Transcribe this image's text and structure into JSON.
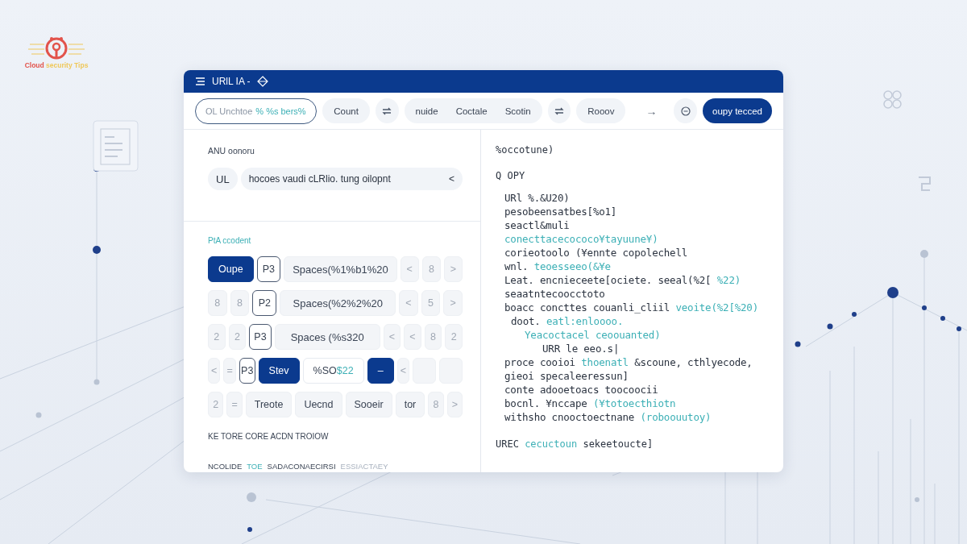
{
  "logo": {
    "words": [
      {
        "text": "Cloud",
        "kind": "primary"
      },
      {
        "text": "security Tips",
        "kind": "secondary"
      }
    ]
  },
  "window": {
    "title": "URlL IA -"
  },
  "toolbar": {
    "field": {
      "value": "OL Unchtoe",
      "accent": "% %s bers%"
    },
    "items": [
      {
        "kind": "chip",
        "text": "Count"
      },
      {
        "kind": "icon"
      },
      {
        "kind": "group",
        "texts": [
          "nuide",
          "Coctale",
          "Scotin"
        ]
      },
      {
        "kind": "icon"
      },
      {
        "kind": "chip",
        "text": "Rooov"
      },
      {
        "kind": "arrow",
        "text": "→"
      },
      {
        "kind": "circle"
      }
    ],
    "primary_button": "oupy tecced"
  },
  "left": {
    "section_1": {
      "label": "ANU oonoru",
      "chip": "UL",
      "field": "hocoes vaudi cLRlio. tung oilopnt",
      "field_icon": "<"
    },
    "section_2": {
      "label": "PtA ccodent",
      "key_rows": [
        {
          "keys": [
            {
              "kind": "primary",
              "text": "Oupe"
            },
            {
              "kind": "outlined",
              "text": "P3"
            },
            {
              "kind": "wide",
              "text": "Spaces(%1%b1%20"
            },
            {
              "kind": "small",
              "text": "<"
            },
            {
              "kind": "small",
              "text": "8"
            },
            {
              "kind": "small",
              "text": ">"
            }
          ]
        },
        {
          "keys": [
            {
              "kind": "small",
              "text": "8"
            },
            {
              "kind": "small",
              "text": "8"
            },
            {
              "kind": "outlined",
              "text": "P2"
            },
            {
              "kind": "wide",
              "text": "Spaces(%2%2%20"
            },
            {
              "kind": "small",
              "text": "<"
            },
            {
              "kind": "small",
              "text": "5"
            },
            {
              "kind": "small",
              "text": ">"
            }
          ]
        },
        {
          "keys": [
            {
              "kind": "small",
              "text": "2"
            },
            {
              "kind": "small",
              "text": "2"
            },
            {
              "kind": "outlined",
              "text": "P3"
            },
            {
              "kind": "wide",
              "text": "Spaces (%s320"
            },
            {
              "kind": "small",
              "text": "<"
            },
            {
              "kind": "small",
              "text": "<"
            },
            {
              "kind": "small",
              "text": "8"
            },
            {
              "kind": "small",
              "text": "2"
            }
          ]
        },
        {
          "keys": [
            {
              "kind": "small",
              "text": "<"
            },
            {
              "kind": "small",
              "text": "="
            },
            {
              "kind": "outlined",
              "text": "P3"
            },
            {
              "kind": "primary",
              "text": "Stev"
            },
            {
              "kind": "white",
              "text": "%SO",
              "accent": "$22"
            },
            {
              "kind": "primary",
              "text": "–"
            },
            {
              "kind": "small",
              "text": "<"
            },
            {
              "kind": "blank"
            },
            {
              "kind": "blank"
            }
          ]
        },
        {
          "keys": [
            {
              "kind": "small",
              "text": "2"
            },
            {
              "kind": "small",
              "text": "="
            },
            {
              "kind": "medium",
              "text": "Treote"
            },
            {
              "kind": "medium",
              "text": "Uecnd"
            },
            {
              "kind": "medium",
              "text": "Sooeir"
            },
            {
              "kind": "medium",
              "text": "tor"
            },
            {
              "kind": "small",
              "text": "8"
            },
            {
              "kind": "small",
              "text": ">"
            }
          ]
        }
      ]
    },
    "note": "KE TORE CORE ACDN TROIOW",
    "footer": [
      {
        "text": "NCOLIDE",
        "kind": "plain"
      },
      {
        "text": "TOE",
        "kind": "accent"
      },
      {
        "text": "SADACONAECIRSI",
        "kind": "plain"
      },
      {
        "text": "ESSIACTAEY",
        "kind": "muted"
      }
    ]
  },
  "code_panel": {
    "heading": "%occotune)",
    "subheading": "Q OPY",
    "lines": [
      {
        "kind": "code",
        "parts": [
          {
            "text": "URl %.&U20)",
            "accent": false
          }
        ]
      },
      {
        "kind": "code",
        "parts": [
          {
            "text": "pesobeensatbes[%o1]",
            "accent": false
          }
        ]
      },
      {
        "kind": "code",
        "parts": [
          {
            "text": "seactl&muli",
            "accent": false
          }
        ]
      },
      {
        "kind": "code",
        "parts": [
          {
            "text": "conecttacecococo¥tayuune¥)",
            "accent": true
          }
        ]
      },
      {
        "kind": "code",
        "parts": [
          {
            "text": "corieotoolo (¥ennte copolechell",
            "accent": false
          }
        ]
      },
      {
        "kind": "code",
        "parts": [
          {
            "text": "wnl.",
            "accent": false
          },
          {
            "text": "teoesseeo(&¥e",
            "accent": true
          }
        ]
      },
      {
        "kind": "code",
        "parts": [
          {
            "text": "Leat. encnieceete[ociete. seeal(%2[",
            "accent": false
          },
          {
            "text": "%22)",
            "accent": true
          }
        ]
      },
      {
        "kind": "code",
        "parts": [
          {
            "text": "seaatntecoocctoto",
            "accent": false
          }
        ]
      },
      {
        "kind": "code",
        "parts": [
          {
            "text": "boacc concttes couanli_cliil",
            "accent": false
          },
          {
            "text": "veoite(%2[%20)",
            "accent": true
          }
        ]
      },
      {
        "kind": "nested",
        "parts": [
          {
            "text": "doot.",
            "accent": false
          },
          {
            "text": "eatl:enloooo.",
            "accent": true
          }
        ]
      },
      {
        "kind": "deep",
        "parts": [
          {
            "text": "Yeacoctacel ceoouanted)",
            "accent": true
          }
        ]
      },
      {
        "kind": "deeper",
        "parts": [
          {
            "text": "URR le eeo.s|",
            "accent": false
          }
        ]
      },
      {
        "kind": "code",
        "parts": [
          {
            "text": "proce cooioi",
            "accent": false
          },
          {
            "text": "thoenatl",
            "accent": true
          },
          {
            "text": "&scoune, cthlyecode,",
            "accent": false
          }
        ]
      },
      {
        "kind": "code",
        "parts": [
          {
            "text": "gieoi specaleeressun]",
            "accent": false
          }
        ]
      },
      {
        "kind": "code",
        "parts": [
          {
            "text": "conte adooetoacs toocoocii",
            "accent": false
          }
        ]
      },
      {
        "kind": "code",
        "parts": [
          {
            "text": "bocnl. ¥nccape",
            "accent": false
          },
          {
            "text": "(¥totoecthiotn",
            "accent": true
          }
        ]
      },
      {
        "kind": "code",
        "parts": [
          {
            "text": "withsho cnooctoectnane",
            "accent": false
          },
          {
            "text": "(roboouutoy)",
            "accent": true
          }
        ]
      }
    ],
    "footer": [
      {
        "text": "UREC",
        "accent": false
      },
      {
        "text": "cecuctoun",
        "accent": true
      },
      {
        "text": "sekeetoucte]",
        "accent": false
      }
    ]
  }
}
